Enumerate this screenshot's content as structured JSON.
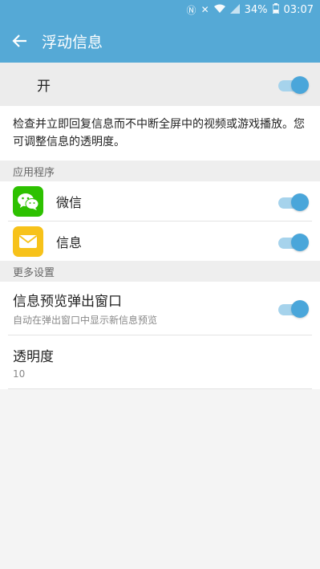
{
  "status_bar": {
    "battery_percent": "34%",
    "time": "03:07"
  },
  "app_bar": {
    "title": "浮动信息"
  },
  "master_switch": {
    "label": "开",
    "enabled": true
  },
  "description": "检查并立即回复信息而不中断全屏中的视频或游戏播放。您可调整信息的透明度。",
  "apps_section": {
    "header": "应用程序",
    "items": [
      {
        "name": "微信",
        "icon": "wechat-icon",
        "enabled": true
      },
      {
        "name": "信息",
        "icon": "message-envelope-icon",
        "enabled": true
      }
    ]
  },
  "more_section": {
    "header": "更多设置",
    "preview": {
      "title": "信息预览弹出窗口",
      "subtitle": "自动在弹出窗口中显示新信息预览",
      "enabled": true
    },
    "transparency": {
      "title": "透明度",
      "value": "10"
    }
  },
  "colors": {
    "accent": "#55a9d6",
    "toggle_on": "#4aa6da"
  }
}
